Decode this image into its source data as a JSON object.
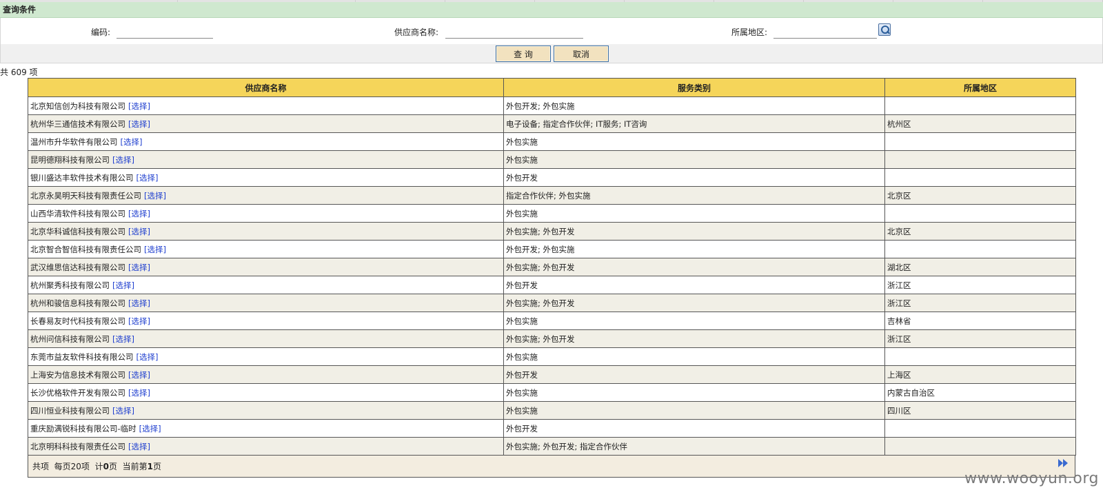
{
  "query": {
    "header": "查询条件",
    "code_label": "编码:",
    "code_value": "",
    "supplier_label": "供应商名称:",
    "supplier_value": "",
    "region_label": "所属地区:",
    "region_value": "",
    "search_label": "查 询",
    "cancel_label": "取消"
  },
  "summary": {
    "count_text": "共 609 项"
  },
  "table": {
    "columns": [
      "供应商名称",
      "服务类别",
      "所属地区"
    ],
    "select_label": "[选择]",
    "rows": [
      {
        "name": "北京知信创为科技有限公司",
        "service": "外包开发; 外包实施",
        "region": ""
      },
      {
        "name": "杭州华三通信技术有限公司",
        "service": "电子设备; 指定合作伙伴; IT服务; IT咨询",
        "region": "杭州区"
      },
      {
        "name": "温州市升华软件有限公司",
        "service": "外包实施",
        "region": ""
      },
      {
        "name": "昆明德翔科技有限公司",
        "service": "外包实施",
        "region": ""
      },
      {
        "name": "银川盛达丰软件技术有限公司",
        "service": "外包开发",
        "region": ""
      },
      {
        "name": "北京永昊明天科技有限责任公司",
        "service": "指定合作伙伴; 外包实施",
        "region": "北京区"
      },
      {
        "name": "山西华清软件科技有限公司",
        "service": "外包实施",
        "region": ""
      },
      {
        "name": "北京华科诚信科技有限公司",
        "service": "外包实施; 外包开发",
        "region": "北京区"
      },
      {
        "name": "北京智合智信科技有限责任公司",
        "service": "外包开发; 外包实施",
        "region": ""
      },
      {
        "name": "武汉维思信达科技有限公司",
        "service": "外包实施; 外包开发",
        "region": "湖北区"
      },
      {
        "name": "杭州聚秀科技有限公司",
        "service": "外包开发",
        "region": "浙江区"
      },
      {
        "name": "杭州和骏信息科技有限公司",
        "service": "外包实施; 外包开发",
        "region": "浙江区"
      },
      {
        "name": "长春易友时代科技有限公司",
        "service": "外包实施",
        "region": "吉林省"
      },
      {
        "name": "杭州问信科技有限公司",
        "service": "外包实施; 外包开发",
        "region": "浙江区"
      },
      {
        "name": "东莞市益友软件科技有限公司",
        "service": "外包实施",
        "region": ""
      },
      {
        "name": "上海安为信息技术有限公司",
        "service": "外包开发",
        "region": "上海区"
      },
      {
        "name": "长沙优格软件开发有限公司",
        "service": "外包实施",
        "region": "内蒙古自治区"
      },
      {
        "name": "四川恒业科技有限公司",
        "service": "外包实施",
        "region": "四川区"
      },
      {
        "name": "重庆励满锐科技有限公司-临时",
        "service": "外包开发",
        "region": ""
      },
      {
        "name": "北京明科科技有限责任公司",
        "service": "外包实施; 外包开发; 指定合作伙伴",
        "region": ""
      }
    ]
  },
  "pager": {
    "total_prefix": "共项",
    "per_page_text": "每页20项",
    "pages_prefix": "计",
    "pages_count": "0",
    "pages_suffix": "页",
    "current_prefix": "当前第",
    "current_page": "1",
    "current_suffix": "页",
    "last_icon": "last-page-icon"
  },
  "watermark": "www.wooyun.org",
  "colors": {
    "header_bg": "#cfe8cf",
    "table_header_bg": "#f5d55a",
    "row_alt_bg": "#f1efe6",
    "link": "#1f3fcf",
    "button_bg": "#f2e2bf"
  }
}
